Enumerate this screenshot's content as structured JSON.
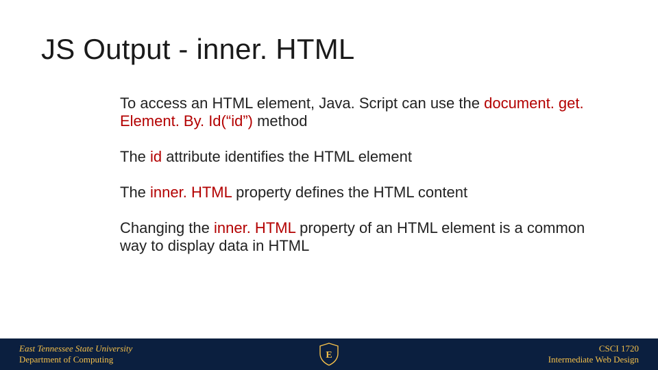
{
  "title": "JS Output - inner. HTML",
  "paragraphs": {
    "p1_a": "To access an HTML element, Java. Script can use the ",
    "p1_hl": "document. get. Element. By. Id(“id”)",
    "p1_b": " method",
    "p2_a": "The ",
    "p2_hl": "id",
    "p2_b": " attribute identifies the HTML element",
    "p3_a": "The ",
    "p3_hl": "inner. HTML",
    "p3_b": " property defines the HTML content",
    "p4_a": "Changing the ",
    "p4_hl": "inner. HTML",
    "p4_b": " property of an HTML element is a common way to display data in HTML"
  },
  "footer": {
    "left_line1": "East Tennessee State University",
    "left_line2": "Department of Computing",
    "right_line1": "CSCI 1720",
    "right_line2": "Intermediate Web Design",
    "logo_letter": "E"
  }
}
